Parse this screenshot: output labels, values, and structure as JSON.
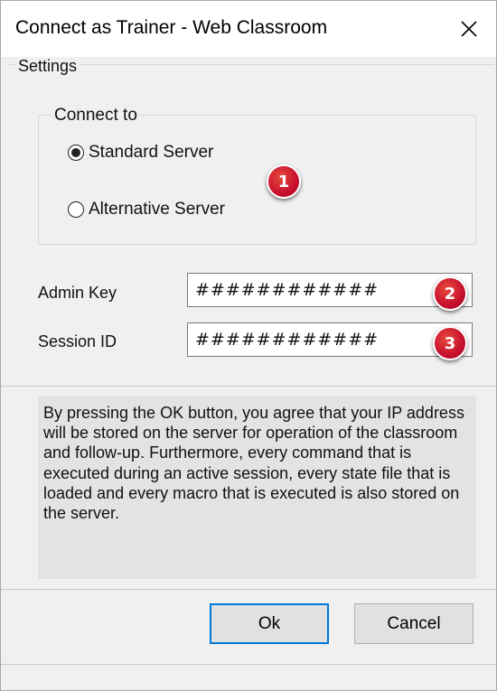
{
  "window": {
    "title": "Connect as Trainer - Web Classroom",
    "close_icon": "close-icon"
  },
  "settings": {
    "legend": "Settings",
    "connect_to": {
      "legend": "Connect to",
      "options": [
        {
          "label": "Standard Server",
          "selected": true
        },
        {
          "label": "Alternative Server",
          "selected": false
        }
      ]
    },
    "admin_key": {
      "label": "Admin Key",
      "value": "############"
    },
    "session_id": {
      "label": "Session ID",
      "value": "############"
    }
  },
  "callouts": [
    "1",
    "2",
    "3"
  ],
  "notice": "By pressing the OK button, you agree that your IP address will be stored on the server for operation of the classroom and follow-up. Furthermore, every command that is executed during an active session, every state file that is loaded and every macro that is executed is also stored on the server.",
  "buttons": {
    "ok": "Ok",
    "cancel": "Cancel"
  },
  "colors": {
    "accent": "#0078d7",
    "callout": "#c8102e"
  }
}
